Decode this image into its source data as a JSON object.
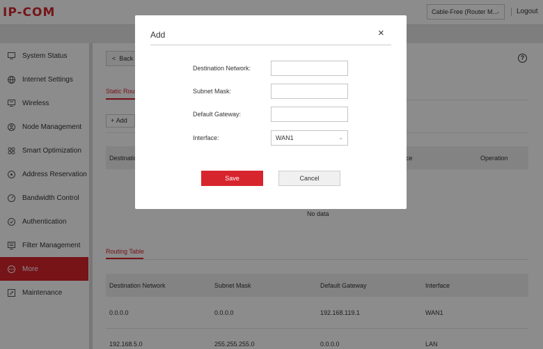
{
  "header": {
    "logo": "IP-COM",
    "mode_select": "Cable-Free (Router M...",
    "logout": "Logout"
  },
  "sidebar": {
    "items": [
      {
        "label": "System Status",
        "icon": "monitor-icon"
      },
      {
        "label": "Internet Settings",
        "icon": "globe-icon"
      },
      {
        "label": "Wireless",
        "icon": "wifi-icon"
      },
      {
        "label": "Node Management",
        "icon": "network-icon"
      },
      {
        "label": "Smart Optimization",
        "icon": "optimize-icon"
      },
      {
        "label": "Address Reservation",
        "icon": "address-icon"
      },
      {
        "label": "Bandwidth Control",
        "icon": "gauge-icon"
      },
      {
        "label": "Authentication",
        "icon": "shield-icon"
      },
      {
        "label": "Filter Management",
        "icon": "filter-icon"
      },
      {
        "label": "More",
        "icon": "more-icon",
        "active": true
      },
      {
        "label": "Maintenance",
        "icon": "wrench-icon"
      }
    ]
  },
  "main": {
    "back_label": "Back",
    "tab_static": "Static Routi",
    "add_label": "Add",
    "static_table": {
      "headers": [
        "Destination",
        "ce",
        "Operation"
      ],
      "empty_text": "No data"
    },
    "tab_routing": "Routing Table",
    "routing_table": {
      "headers": [
        "Destination Network",
        "Subnet Mask",
        "Default Gateway",
        "Interface"
      ],
      "rows": [
        [
          "0.0.0.0",
          "0.0.0.0",
          "192.168.119.1",
          "WAN1"
        ],
        [
          "192.168.5.0",
          "255.255.255.0",
          "0.0.0.0",
          "LAN"
        ]
      ]
    }
  },
  "modal": {
    "title": "Add",
    "close": "×",
    "fields": {
      "destination_network_label": "Destination Network:",
      "subnet_mask_label": "Subnet Mask:",
      "default_gateway_label": "Default Gateway:",
      "interface_label": "Interface:",
      "interface_value": "WAN1"
    },
    "save_label": "Save",
    "cancel_label": "Cancel"
  },
  "colors": {
    "accent": "#d7252d",
    "overlay": "rgba(0,0,0,0.45)"
  }
}
